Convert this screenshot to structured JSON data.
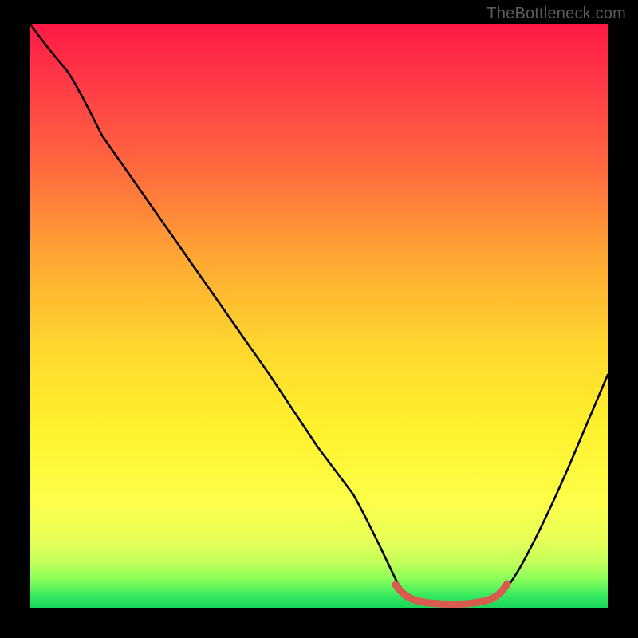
{
  "watermark": "TheBottleneck.com",
  "chart_data": {
    "type": "line",
    "title": "",
    "xlabel": "",
    "ylabel": "",
    "xlim": [
      0,
      100
    ],
    "ylim": [
      0,
      100
    ],
    "series": [
      {
        "name": "curve",
        "x": [
          0,
          3,
          6,
          10,
          20,
          30,
          40,
          50,
          56,
          60,
          63,
          70,
          75,
          80,
          85,
          90,
          95,
          100
        ],
        "y": [
          100,
          97,
          94.5,
          92,
          79,
          66,
          53,
          39,
          30,
          20,
          12,
          2,
          1,
          1.5,
          4,
          14,
          27,
          40
        ]
      }
    ],
    "highlight": {
      "name": "min-region",
      "x": [
        63,
        65,
        70,
        75,
        80,
        82
      ],
      "y": [
        3,
        2,
        1,
        1,
        1.5,
        3
      ],
      "color": "#d95a4e"
    },
    "background_gradient": [
      "#ff1a44",
      "#ffd92e",
      "#19d45c"
    ]
  }
}
